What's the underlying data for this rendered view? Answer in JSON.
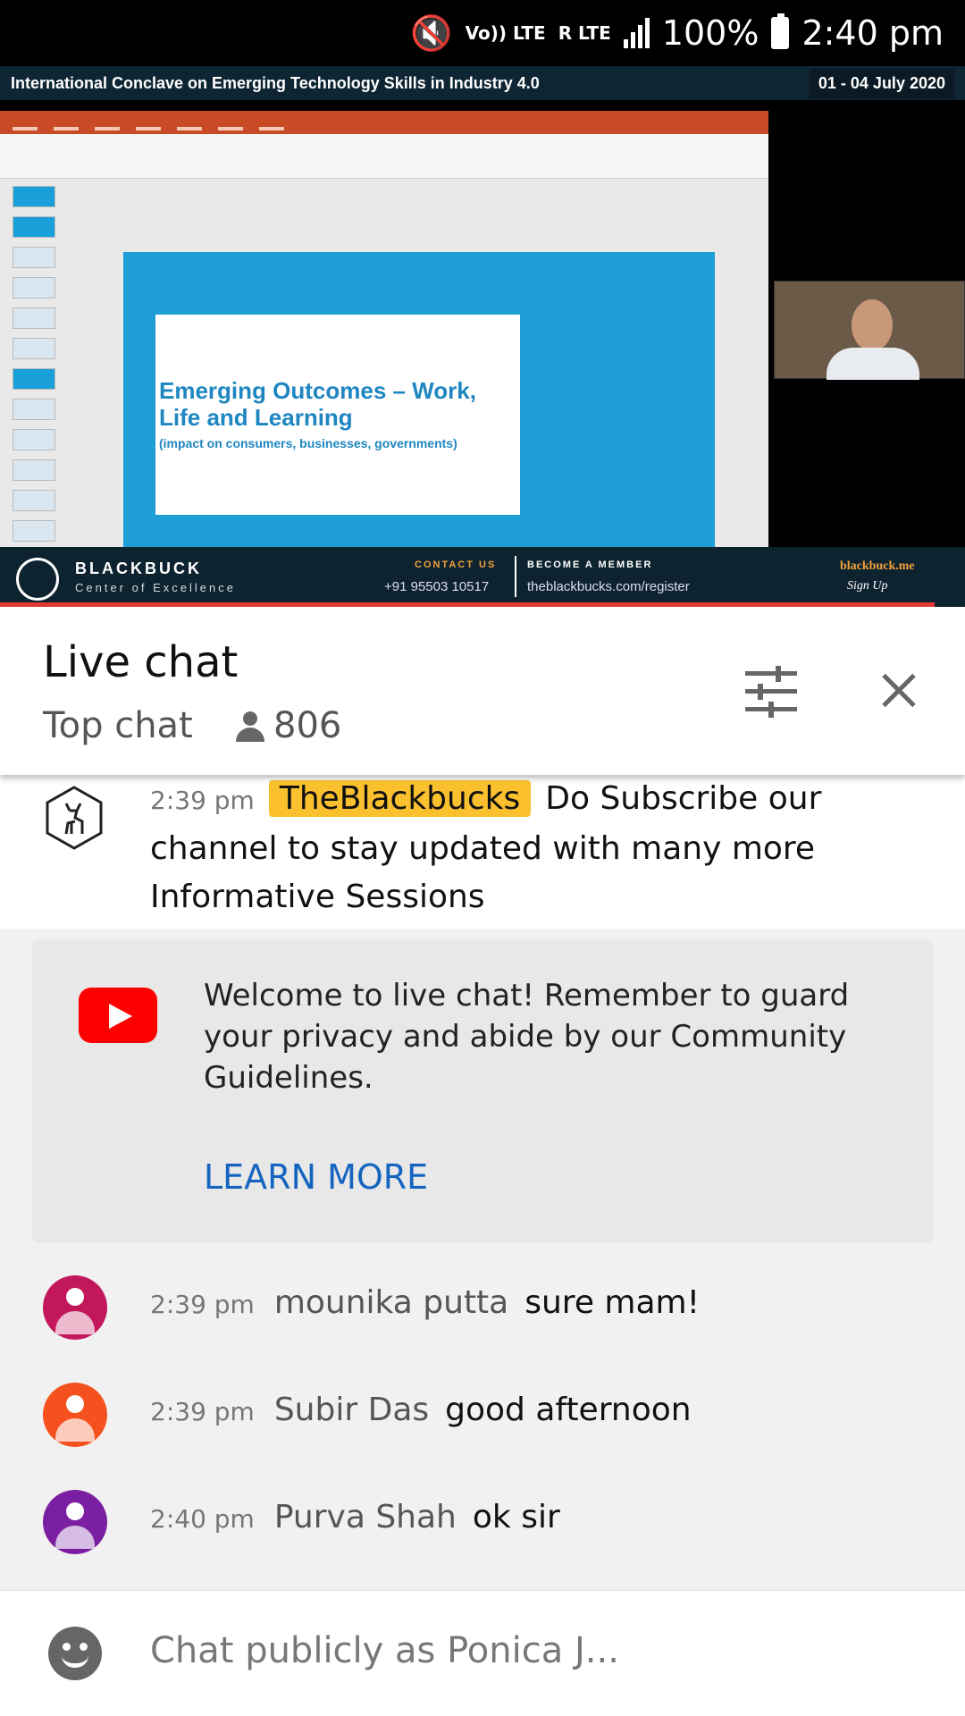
{
  "status_bar": {
    "volte": "Vo)) LTE",
    "lte": "R LTE",
    "battery": "100%",
    "time": "2:40 pm"
  },
  "video": {
    "banner_title": "International Conclave on Emerging Technology Skills in Industry 4.0",
    "banner_date": "01 - 04 July 2020",
    "slide_title": "Emerging Outcomes – Work, Life and Learning",
    "slide_subtitle": "(impact on consumers, businesses, governments)",
    "brand": "BLACKBUCK",
    "brand_sub": "Center of Excellence",
    "contact_heading": "CONTACT US",
    "contact_phone": "+91 95503 10517",
    "member_heading": "BECOME A MEMBER",
    "member_url": "theblackbucks.com/register",
    "site": "blackbuck.me",
    "signup": "Sign Up"
  },
  "chat_header": {
    "title": "Live chat",
    "mode": "Top chat",
    "viewers": "806"
  },
  "pinned": {
    "time": "2:39 pm",
    "author": "TheBlackbucks",
    "message": "Do Subscribe our channel to stay updated with many more Informative Sessions"
  },
  "welcome": {
    "text": "Welcome to live chat! Remember to guard your privacy and abide by our Community Guidelines.",
    "link": "LEARN MORE"
  },
  "messages": [
    {
      "time": "2:39 pm",
      "author": "mounika putta",
      "text": "sure mam!",
      "color": "#c2185b"
    },
    {
      "time": "2:39 pm",
      "author": "Subir Das",
      "text": "good afternoon",
      "color": "#f4511e"
    },
    {
      "time": "2:40 pm",
      "author": "Purva Shah",
      "text": "ok sir",
      "color": "#7b1fa2"
    }
  ],
  "input": {
    "placeholder": "Chat publicly as Ponica J..."
  }
}
